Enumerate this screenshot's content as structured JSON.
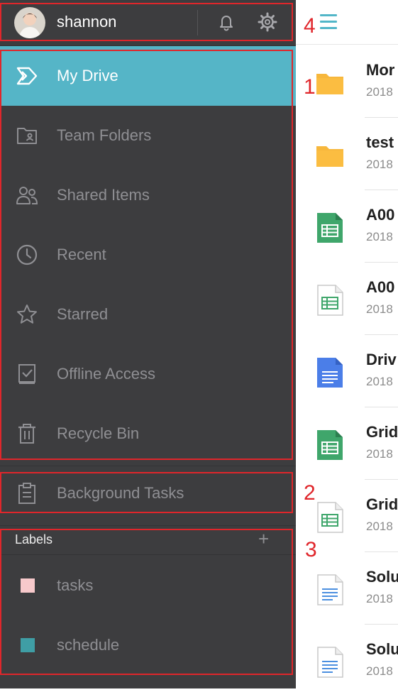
{
  "profile": {
    "username": "shannon",
    "icons": [
      "avatar",
      "bell-icon",
      "gear-icon"
    ]
  },
  "nav": [
    {
      "label": "My Drive",
      "icon": "drive-icon",
      "active": true
    },
    {
      "label": "Team Folders",
      "icon": "team-folder-icon"
    },
    {
      "label": "Shared Items",
      "icon": "people-icon"
    },
    {
      "label": "Recent",
      "icon": "clock-icon"
    },
    {
      "label": "Starred",
      "icon": "star-icon"
    },
    {
      "label": "Offline Access",
      "icon": "offline-check-icon"
    },
    {
      "label": "Recycle Bin",
      "icon": "trash-icon"
    }
  ],
  "background_tasks": {
    "label": "Background Tasks",
    "icon": "clipboard-icon"
  },
  "labels": {
    "title": "Labels",
    "add_symbol": "+",
    "items": [
      {
        "name": "tasks",
        "color": "#f7c9cb"
      },
      {
        "name": "schedule",
        "color": "#3f9ea5"
      }
    ]
  },
  "files": [
    {
      "name": "Mor",
      "date": "2018",
      "type": "folder"
    },
    {
      "name": "test",
      "date": "2018",
      "type": "folder"
    },
    {
      "name": "A00",
      "date": "2018",
      "type": "spreadsheet"
    },
    {
      "name": "A00",
      "date": "2018",
      "type": "spreadsheet-outline"
    },
    {
      "name": "Driv",
      "date": "2018",
      "type": "document"
    },
    {
      "name": "Grid",
      "date": "2018",
      "type": "spreadsheet"
    },
    {
      "name": "Grid",
      "date": "2018",
      "type": "spreadsheet-outline"
    },
    {
      "name": "Solu",
      "date": "2018",
      "type": "text-file"
    },
    {
      "name": "Solu",
      "date": "2018",
      "type": "text-file"
    }
  ],
  "annotations": [
    "1",
    "2",
    "3",
    "4"
  ],
  "colors": {
    "drawer_bg": "#3d3d3f",
    "accent": "#55b5c7",
    "annotation": "#e0262b",
    "folder": "#f7b73c",
    "sheet": "#3fa66b",
    "doc": "#4b7ee8"
  }
}
